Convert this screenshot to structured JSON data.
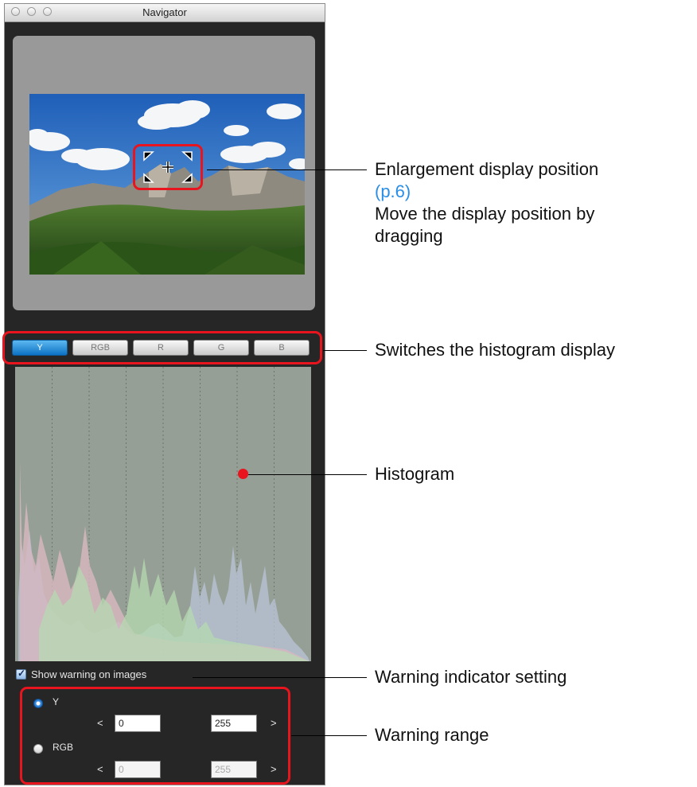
{
  "window": {
    "title": "Navigator"
  },
  "histogram_tabs": [
    "Y",
    "RGB",
    "R",
    "G",
    "B"
  ],
  "active_tab": "Y",
  "warning": {
    "show_label": "Show warning on images",
    "checked": true,
    "options": [
      {
        "label": "Y",
        "selected": true,
        "lt": "<",
        "gt": ">",
        "low": "0",
        "high": "255"
      },
      {
        "label": "RGB",
        "selected": false,
        "lt": "<",
        "gt": ">",
        "low": "0",
        "high": "255"
      }
    ]
  },
  "annotations": {
    "enlargement_title": "Enlargement display position",
    "enlargement_ref": "(p.6)",
    "enlargement_line2": "Move the display position by",
    "enlargement_line3": "dragging",
    "histogram_switch": "Switches the histogram display",
    "histogram": "Histogram",
    "warning_indicator": "Warning indicator setting",
    "warning_range": "Warning range"
  },
  "colors": {
    "callout_red": "#e8141e",
    "reference_blue": "#2a8ee8",
    "active_tab_blue": "#1a82d0",
    "histogram_bg": "#959f95"
  }
}
